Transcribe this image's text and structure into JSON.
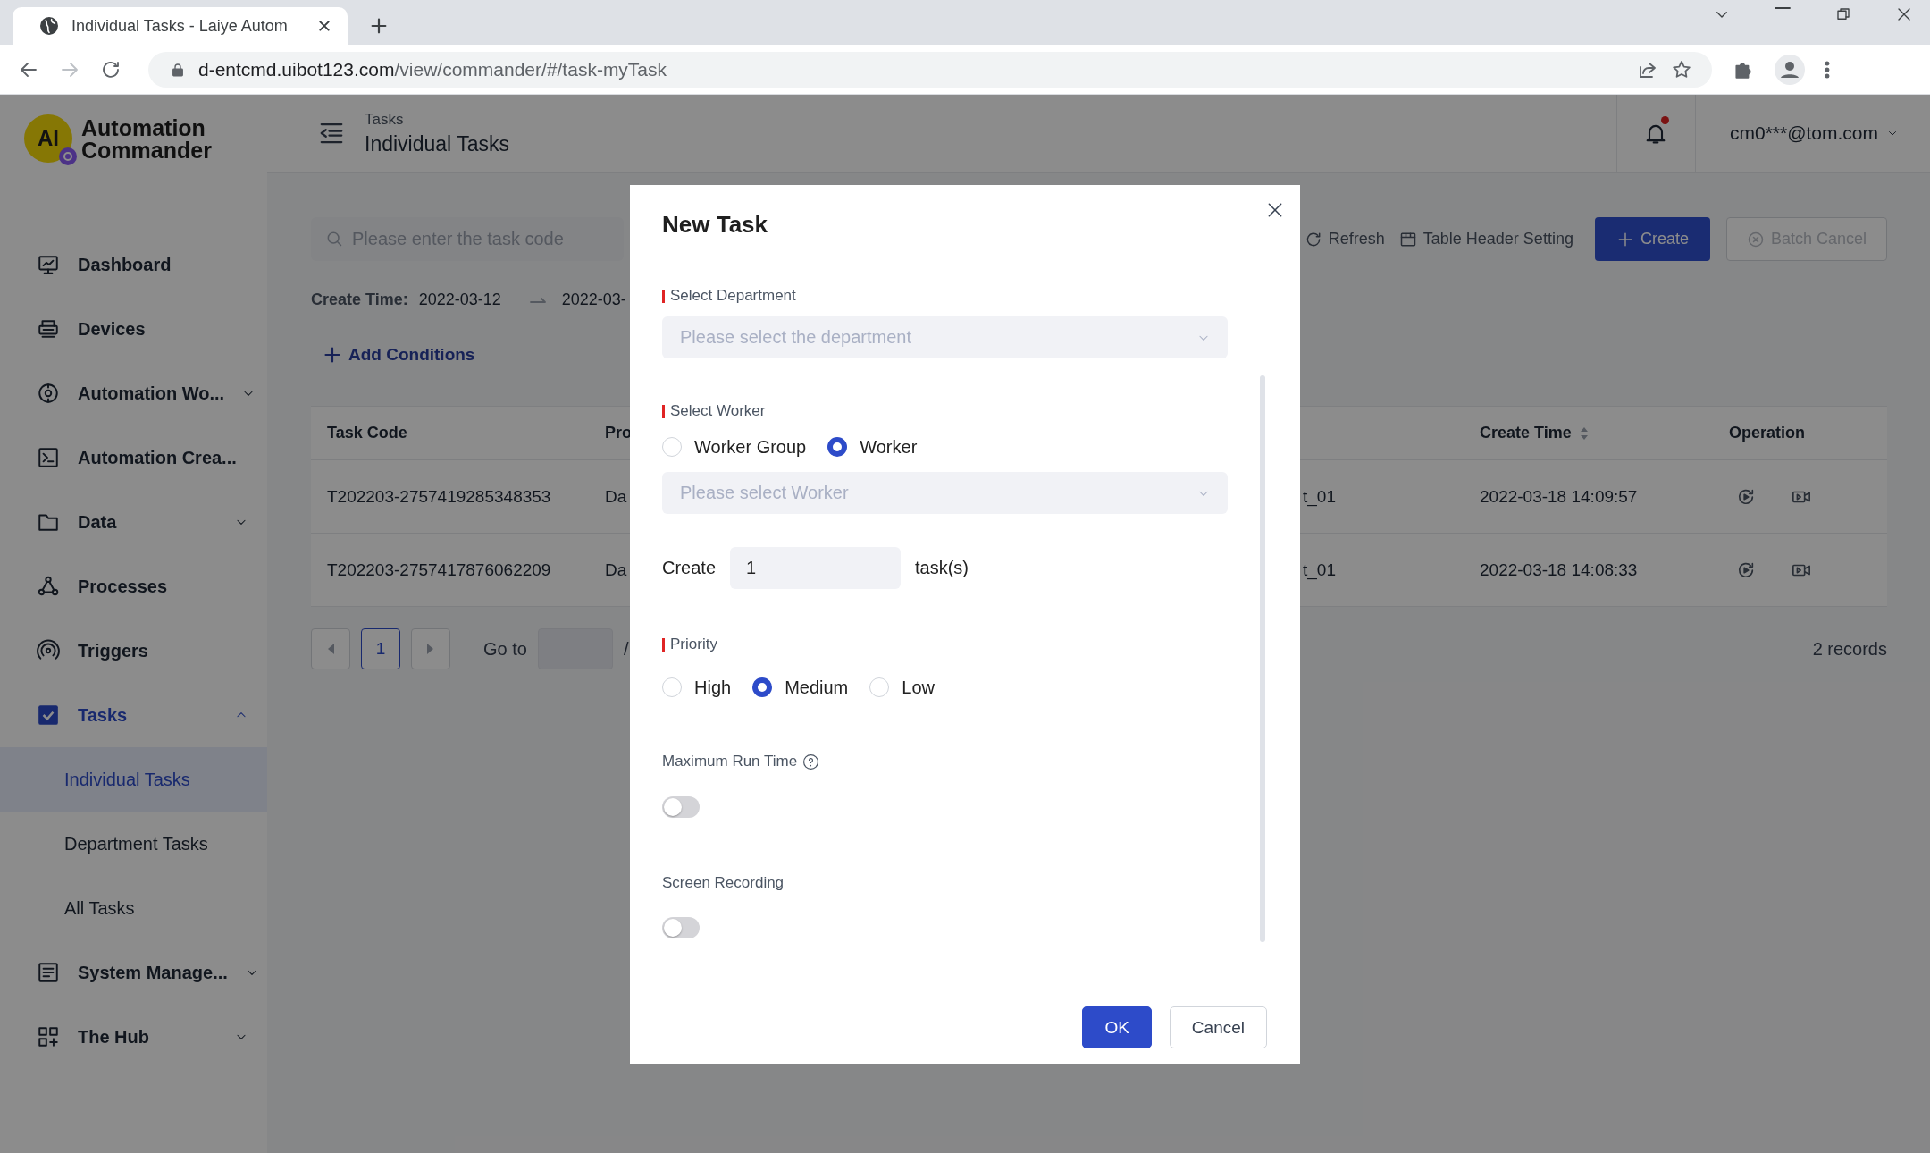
{
  "browser": {
    "tab_title": "Individual Tasks - Laiye Autom",
    "url_domain": "d-entcmd.uibot123.com",
    "url_path": "/view/commander/#/task-myTask"
  },
  "logo": {
    "mark": "AI",
    "name_lines": [
      "Automation",
      "Commander"
    ]
  },
  "sidebar": {
    "items": [
      {
        "label": "Dashboard",
        "kind": "link",
        "selected": false
      },
      {
        "label": "Devices",
        "kind": "link",
        "selected": false
      },
      {
        "label": "Automation Wo...",
        "kind": "group",
        "selected": false,
        "expanded": false
      },
      {
        "label": "Automation Crea...",
        "kind": "link",
        "selected": false
      },
      {
        "label": "Data",
        "kind": "group",
        "selected": false,
        "expanded": false
      },
      {
        "label": "Processes",
        "kind": "link",
        "selected": false
      },
      {
        "label": "Triggers",
        "kind": "link",
        "selected": false
      },
      {
        "label": "Tasks",
        "kind": "group",
        "selected": true,
        "expanded": true,
        "children": [
          {
            "label": "Individual Tasks",
            "selected": true
          },
          {
            "label": "Department Tasks",
            "selected": false
          },
          {
            "label": "All Tasks",
            "selected": false
          }
        ]
      },
      {
        "label": "System Manage...",
        "kind": "group",
        "selected": false,
        "expanded": false
      },
      {
        "label": "The Hub",
        "kind": "group",
        "selected": false,
        "expanded": false
      }
    ]
  },
  "header": {
    "breadcrumb": "Tasks",
    "title": "Individual Tasks",
    "unread": true,
    "user": "cm0***@tom.com"
  },
  "toolbar": {
    "search": {
      "placeholder": "Please enter the task code"
    },
    "actions": [
      {
        "label": "Refresh",
        "kind": "link",
        "disabled": false
      },
      {
        "label": "Table Header Setting",
        "kind": "link",
        "disabled": false
      },
      {
        "label": "Create",
        "kind": "primary",
        "disabled": false
      },
      {
        "label": "Batch Cancel",
        "kind": "outline",
        "disabled": true
      }
    ]
  },
  "filters": {
    "create_time": {
      "label": "Create Time:",
      "from": "2022-03-12",
      "to": "2022-03-"
    },
    "add_conditions": "Add Conditions"
  },
  "table": {
    "columns": [
      {
        "label": "Task Code"
      },
      {
        "label": "Pro"
      },
      {},
      {
        "label": "Create Time",
        "sortable": true
      },
      {
        "label": "Operation"
      }
    ],
    "rows": [
      {
        "cells": [
          "T202203-2757419285348353",
          "Da",
          "t_01",
          "2022-03-18 14:09:57"
        ]
      },
      {
        "cells": [
          "T202203-2757417876062209",
          "Da",
          "t_01",
          "2022-03-18 14:08:33"
        ]
      }
    ]
  },
  "pagination": {
    "pages": [
      {
        "label": "1",
        "selected": true
      }
    ],
    "goto_label": "Go to",
    "total_prefix": "/",
    "records": "2 records"
  },
  "modal": {
    "title": "New Task",
    "department": {
      "label": "Select Department",
      "required": true,
      "placeholder": "Please select the department"
    },
    "worker": {
      "label": "Select Worker",
      "required": true,
      "options": [
        {
          "label": "Worker Group",
          "selected": false
        },
        {
          "label": "Worker",
          "selected": true
        }
      ],
      "placeholder": "Please select Worker"
    },
    "count": {
      "prefix": "Create",
      "value": "1",
      "suffix": "task(s)"
    },
    "priority": {
      "label": "Priority",
      "required": true,
      "options": [
        {
          "label": "High",
          "selected": false
        },
        {
          "label": "Medium",
          "selected": true
        },
        {
          "label": "Low",
          "selected": false
        }
      ]
    },
    "max_run_time": {
      "label": "Maximum Run Time",
      "required": false,
      "on": false
    },
    "screen_recording": {
      "label": "Screen Recording",
      "required": false,
      "on": false
    },
    "buttons": [
      {
        "label": "OK",
        "kind": "primary"
      },
      {
        "label": "Cancel",
        "kind": "default"
      }
    ]
  }
}
